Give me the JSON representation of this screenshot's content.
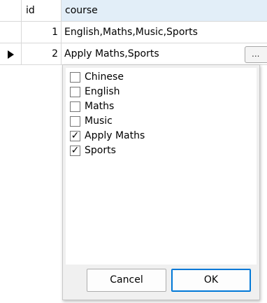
{
  "columns": {
    "id": "id",
    "course": "course"
  },
  "rows": [
    {
      "id": "1",
      "course": "English,Maths,Music,Sports"
    },
    {
      "id": "2",
      "course": "Apply Maths,Sports"
    }
  ],
  "editor": {
    "ellipsis_label": "...",
    "options": [
      {
        "label": "Chinese",
        "checked": false
      },
      {
        "label": "English",
        "checked": false
      },
      {
        "label": "Maths",
        "checked": false
      },
      {
        "label": "Music",
        "checked": false
      },
      {
        "label": "Apply Maths",
        "checked": true
      },
      {
        "label": "Sports",
        "checked": true
      }
    ],
    "check_mark": "✓",
    "cancel_label": "Cancel",
    "ok_label": "OK"
  },
  "icons": {
    "current_row": "current-row-arrow-icon"
  },
  "colors": {
    "header_course_bg": "#e2eef8",
    "ok_border": "#0078d7"
  }
}
